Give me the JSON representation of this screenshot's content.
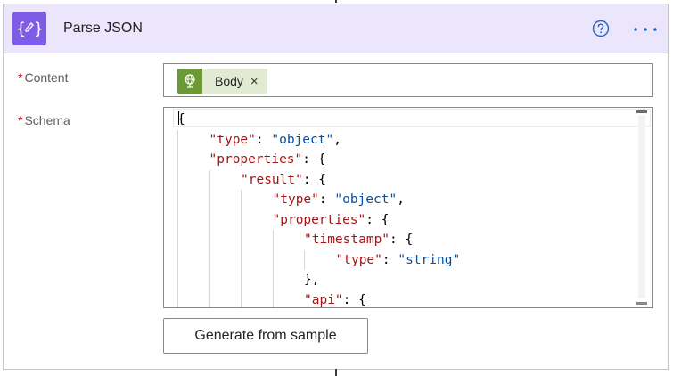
{
  "action": {
    "title": "Parse JSON",
    "icon": "curly-braces-icon",
    "accent_color": "#7f5ce6",
    "header_color": "#ebe6fb"
  },
  "content_field": {
    "required_mark": "*",
    "label": "Content",
    "token": {
      "label": "Body",
      "icon": "http-globe-icon",
      "color": "#6b9a34",
      "remove": "×"
    }
  },
  "schema_field": {
    "required_mark": "*",
    "label": "Schema",
    "lines": [
      {
        "indent": 0,
        "parts": [
          {
            "t": "p",
            "v": "{"
          }
        ]
      },
      {
        "indent": 1,
        "parts": [
          {
            "t": "k",
            "v": "\"type\""
          },
          {
            "t": "p",
            "v": ": "
          },
          {
            "t": "s",
            "v": "\"object\""
          },
          {
            "t": "p",
            "v": ","
          }
        ]
      },
      {
        "indent": 1,
        "parts": [
          {
            "t": "k",
            "v": "\"properties\""
          },
          {
            "t": "p",
            "v": ": {"
          }
        ]
      },
      {
        "indent": 2,
        "parts": [
          {
            "t": "k",
            "v": "\"result\""
          },
          {
            "t": "p",
            "v": ": {"
          }
        ]
      },
      {
        "indent": 3,
        "parts": [
          {
            "t": "k",
            "v": "\"type\""
          },
          {
            "t": "p",
            "v": ": "
          },
          {
            "t": "s",
            "v": "\"object\""
          },
          {
            "t": "p",
            "v": ","
          }
        ]
      },
      {
        "indent": 3,
        "parts": [
          {
            "t": "k",
            "v": "\"properties\""
          },
          {
            "t": "p",
            "v": ": {"
          }
        ]
      },
      {
        "indent": 4,
        "parts": [
          {
            "t": "k",
            "v": "\"timestamp\""
          },
          {
            "t": "p",
            "v": ": {"
          }
        ]
      },
      {
        "indent": 5,
        "parts": [
          {
            "t": "k",
            "v": "\"type\""
          },
          {
            "t": "p",
            "v": ": "
          },
          {
            "t": "s",
            "v": "\"string\""
          }
        ]
      },
      {
        "indent": 4,
        "parts": [
          {
            "t": "p",
            "v": "},"
          }
        ]
      },
      {
        "indent": 4,
        "parts": [
          {
            "t": "k",
            "v": "\"api\""
          },
          {
            "t": "p",
            "v": ": {"
          }
        ]
      }
    ]
  },
  "generate_button": {
    "label": "Generate from sample"
  }
}
